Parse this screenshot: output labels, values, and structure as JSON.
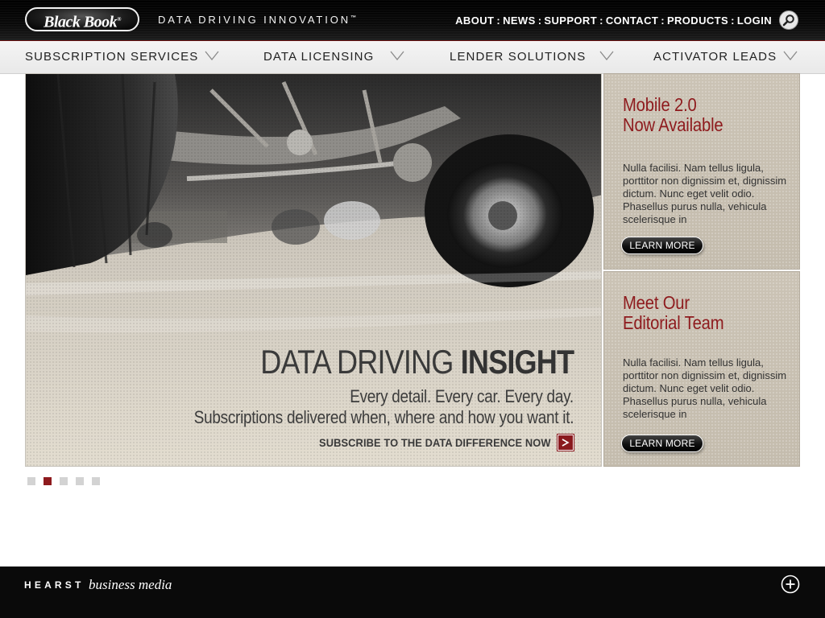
{
  "header": {
    "logo_text": "Black Book",
    "logo_mark": "®",
    "tagline": "DATA DRIVING INNOVATION",
    "tagline_mark": "™",
    "links": [
      "ABOUT",
      "NEWS",
      "SUPPORT",
      "CONTACT",
      "PRODUCTS",
      "LOGIN"
    ],
    "link_separator": ":",
    "search_icon": "search-icon"
  },
  "nav": {
    "items": [
      {
        "label": "SUBSCRIPTION SERVICES",
        "icon": "chevron-down-icon"
      },
      {
        "label": "DATA LICENSING",
        "icon": "chevron-down-icon"
      },
      {
        "label": "LENDER SOLUTIONS",
        "icon": "chevron-down-icon"
      },
      {
        "label": "ACTIVATOR LEADS",
        "icon": "chevron-down-icon"
      }
    ]
  },
  "hero": {
    "title_light": "DATA DRIVING ",
    "title_bold": "INSIGHT",
    "line1": "Every detail. Every car. Every day.",
    "line2": "Subscriptions delivered when, where and how you want it.",
    "cta_label": "SUBSCRIBE TO THE DATA DIFFERENCE NOW",
    "cta_icon": "arrow-right-icon"
  },
  "promos": [
    {
      "title_line1": "Mobile 2.0",
      "title_line2": "Now Available",
      "body": "Nulla facilisi. Nam tellus ligula, porttitor non dignissim et, dignissim dictum. Nunc eget velit odio. Phasellus purus nulla, vehicula scelerisque in",
      "button_label": "LEARN MORE"
    },
    {
      "title_line1": "Meet Our",
      "title_line2": "Editorial Team",
      "body": "Nulla facilisi. Nam tellus ligula, porttitor non dignissim et, dignissim dictum. Nunc eget velit odio. Phasellus purus nulla, vehicula scelerisque in",
      "button_label": "LEARN MORE"
    }
  ],
  "pager": {
    "count": 5,
    "active_index": 1
  },
  "footer": {
    "brand_word": "HEARST",
    "brand_sub": "business media",
    "expand_icon": "plus-circle-icon"
  },
  "colors": {
    "accent_red": "#8e1a1d",
    "header_bg": "#000000",
    "nav_bg": "#efefef",
    "promo_bg": "#c9c1b3",
    "footer_bg": "#0a0a0a"
  }
}
